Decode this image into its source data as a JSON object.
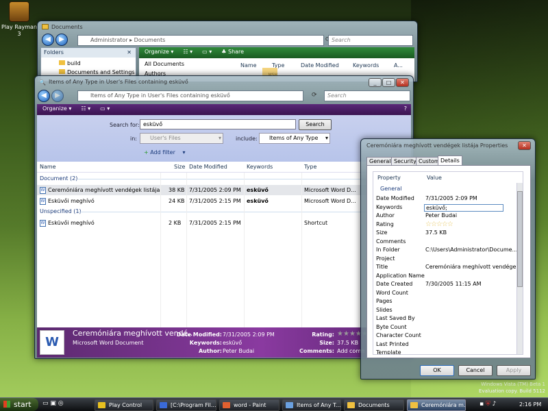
{
  "desktop": {
    "icon_label": "Play Rayman 3",
    "watermark_line1": "Windows Vista (TM) Beta 1",
    "watermark_line2": "Evaluation copy. Build 5112"
  },
  "docs_window": {
    "title": "Documents",
    "breadcrumb": [
      "Administrator",
      "Documents"
    ],
    "search_placeholder": "Search",
    "toolbar": {
      "organize": "Organize",
      "share": "Share"
    },
    "folders_header": "Folders",
    "folder_items": [
      "build",
      "Documents and Settings"
    ],
    "list_items": [
      "All Documents",
      "Authors"
    ],
    "columns": [
      "Name",
      "Type",
      "Date Modified",
      "Keywords",
      "A..."
    ],
    "watermark_text": "MSH"
  },
  "search_window": {
    "title": "Items of Any Type in User's Files containing esküvő",
    "address": "Items of Any Type in User's Files containing esküvő",
    "search_placeholder": "Search",
    "toolbar": {
      "organize": "Organize"
    },
    "search_for_label": "Search for:",
    "search_for_value": "esküvő",
    "search_button": "Search",
    "in_label": "in:",
    "in_value": "User's Files",
    "include_label": "include:",
    "include_value": "Items of Any Type",
    "add_filter": "Add filter",
    "columns": {
      "name": "Name",
      "size": "Size",
      "date": "Date Modified",
      "keywords": "Keywords",
      "type": "Type"
    },
    "groups": [
      {
        "header": "Document (2)",
        "rows": [
          {
            "name": "Ceremóniára meghívott vendégek listája",
            "size": "38 KB",
            "date": "7/31/2005 2:09 PM",
            "keywords": "esküvő",
            "type": "Microsoft Word D..."
          },
          {
            "name": "Esküvői meghívó",
            "size": "24 KB",
            "date": "7/31/2005 2:15 PM",
            "keywords": "esküvő",
            "type": "Microsoft Word D..."
          }
        ]
      },
      {
        "header": "Unspecified (1)",
        "rows": [
          {
            "name": "Esküvői meghívó",
            "size": "2 KB",
            "date": "7/31/2005 2:15 PM",
            "keywords": "",
            "type": "Shortcut"
          }
        ]
      }
    ],
    "details": {
      "title": "Ceremóniára meghívott vendé...",
      "subtitle": "Microsoft Word Document",
      "date_label": "Date Modified:",
      "date_value": "7/31/2005 2:09 PM",
      "keywords_label": "Keywords:",
      "keywords_value": "esküvő",
      "author_label": "Author:",
      "author_value": "Peter Budai",
      "rating_label": "Rating:",
      "size_label": "Size:",
      "size_value": "37.5 KB",
      "comments_label": "Comments:",
      "comments_value": "Add comme"
    }
  },
  "props_window": {
    "title": "Ceremóniára meghívott vendégek listája Properties",
    "tabs": [
      "General",
      "Security",
      "Custom",
      "Details"
    ],
    "col_property": "Property",
    "col_value": "Value",
    "group": "General",
    "rows": [
      {
        "p": "Date Modified",
        "v": "7/31/2005 2:09 PM"
      },
      {
        "p": "Keywords",
        "v": "esküvő;"
      },
      {
        "p": "Author",
        "v": "Peter Budai"
      },
      {
        "p": "Rating",
        "v": ""
      },
      {
        "p": "Size",
        "v": "37.5 KB"
      },
      {
        "p": "Comments",
        "v": ""
      },
      {
        "p": "In Folder",
        "v": "C:\\Users\\Administrator\\Docume..."
      },
      {
        "p": "Project",
        "v": ""
      },
      {
        "p": "Title",
        "v": "Ceremóniára meghívott vendége..."
      },
      {
        "p": "Application Name",
        "v": ""
      },
      {
        "p": "Date Created",
        "v": "7/30/2005 11:15 AM"
      },
      {
        "p": "Word Count",
        "v": ""
      },
      {
        "p": "Pages",
        "v": ""
      },
      {
        "p": "Slides",
        "v": ""
      },
      {
        "p": "Last Saved By",
        "v": ""
      },
      {
        "p": "Byte Count",
        "v": ""
      },
      {
        "p": "Character Count",
        "v": ""
      },
      {
        "p": "Last Printed",
        "v": ""
      },
      {
        "p": "Template",
        "v": ""
      }
    ],
    "ok": "OK",
    "cancel": "Cancel",
    "apply": "Apply"
  },
  "taskbar": {
    "start": "start",
    "clock": "2:16 PM",
    "items": [
      {
        "label": "Play Control",
        "color": "#e8c020"
      },
      {
        "label": "[C:\\Program Fil...",
        "color": "#3a6ad8"
      },
      {
        "label": "word - Paint",
        "color": "#e06030"
      },
      {
        "label": "Items of Any T...",
        "color": "#6aa0e0"
      },
      {
        "label": "Documents",
        "color": "#f0c040"
      },
      {
        "label": "Ceremóniára m...",
        "color": "#f0c040"
      }
    ]
  }
}
